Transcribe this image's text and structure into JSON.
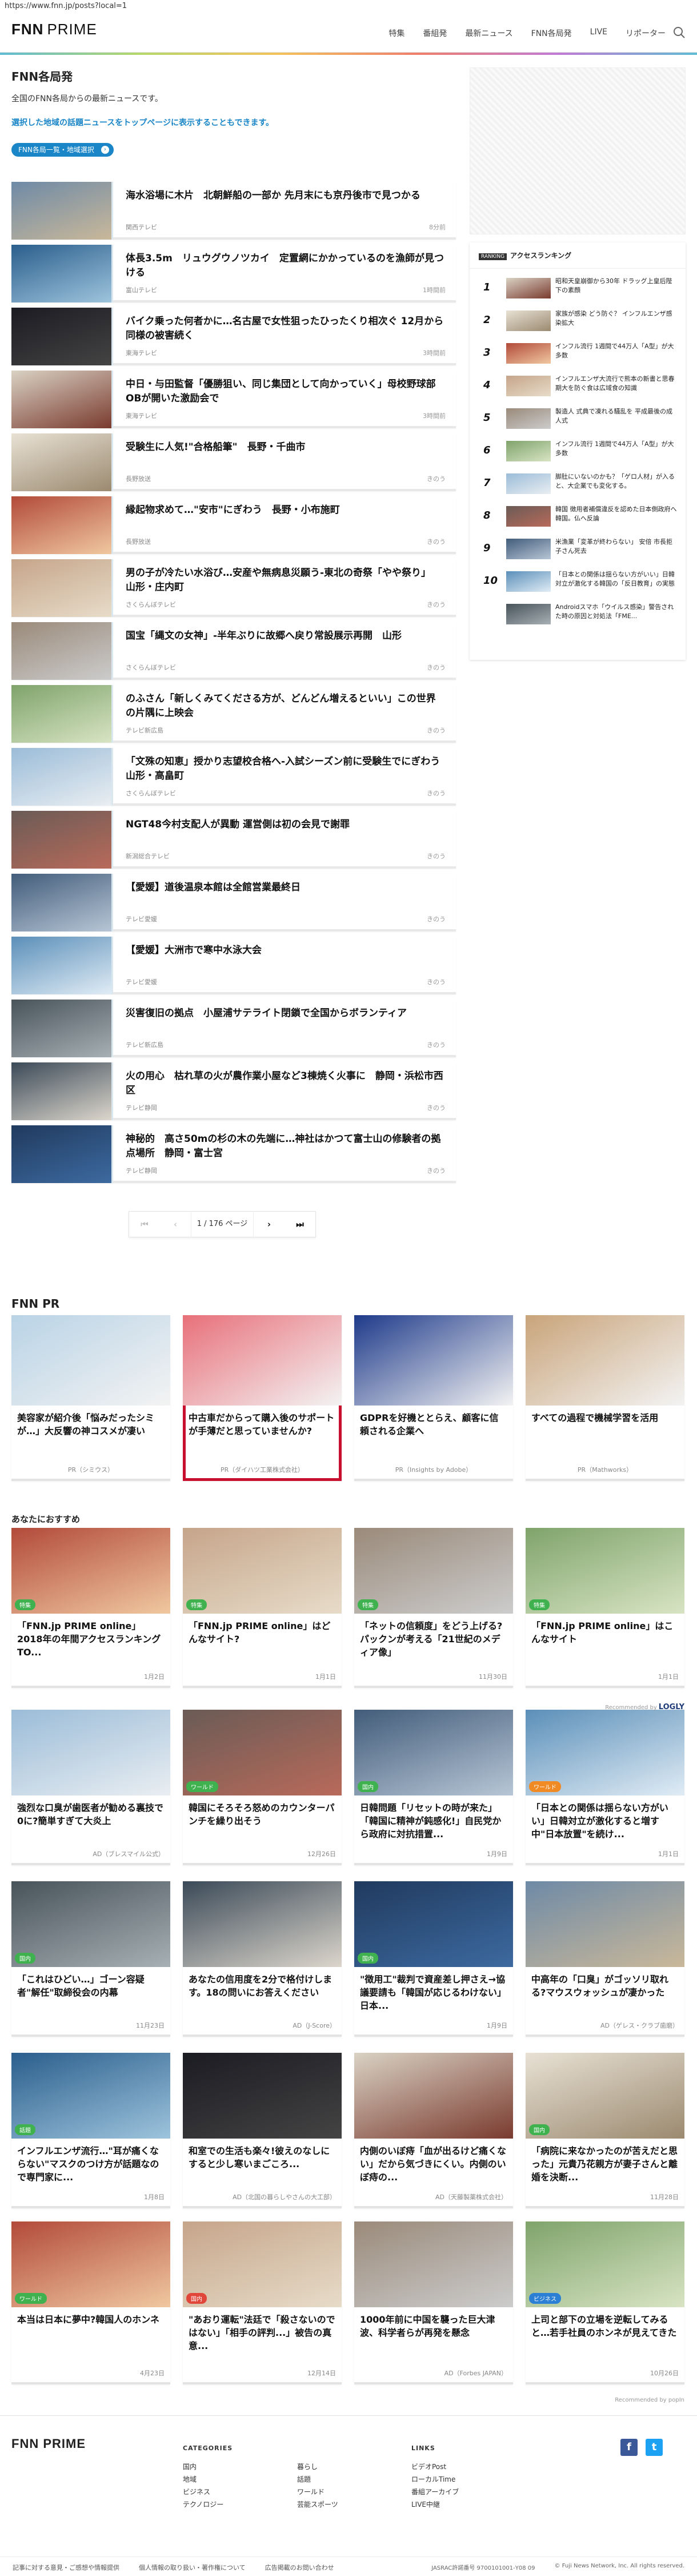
{
  "url": "https://www.fnn.jp/posts?local=1",
  "site": {
    "logo": "FNN",
    "logo_sub": "PRIME",
    "nav": [
      "特集",
      "番組発",
      "最新ニュース",
      "FNN各局発",
      "LIVE",
      "リポーター"
    ]
  },
  "page": {
    "title": "FNN各局発",
    "desc": "全国のFNN各局からの最新ニュースです。",
    "desc2": "選択した地域の話題ニュースをトップページに表示することもできます。",
    "region_button": "FNN各局一覧・地域選択"
  },
  "news": [
    {
      "title": "海水浴場に木片　北朝鮮船の一部か 先月末にも京丹後市で見つかる",
      "source": "関西テレビ",
      "date": "8分前"
    },
    {
      "title": "体長3.5m　リュウグウノツカイ　定置網にかかっているのを漁師が見つける",
      "source": "富山テレビ",
      "date": "1時間前"
    },
    {
      "title": "バイク乗った何者かに…名古屋で女性狙ったひったくり相次ぐ 12月から同様の被害続く",
      "source": "東海テレビ",
      "date": "3時間前"
    },
    {
      "title": "中日・与田監督「優勝狙い、同じ集団として向かっていく」母校野球部OBが開いた激励会で",
      "source": "東海テレビ",
      "date": "3時間前"
    },
    {
      "title": "受験生に人気!\"合格船筆\"　長野・千曲市",
      "source": "長野放送",
      "date": "きのう"
    },
    {
      "title": "縁起物求めて…\"安市\"にぎわう　長野・小布施町",
      "source": "長野放送",
      "date": "きのう"
    },
    {
      "title": "男の子が冷たい水浴び…安産や無病息災願う-東北の奇祭「やや祭り」　山形・庄内町",
      "source": "さくらんぼテレビ",
      "date": "きのう"
    },
    {
      "title": "国宝「縄文の女神」-半年ぶりに故郷へ戻り常設展示再開　山形",
      "source": "さくらんぼテレビ",
      "date": "きのう"
    },
    {
      "title": "のふさん「新しくみてくださる方が、どんどん増えるといい」この世界の片隅に上映会",
      "source": "テレビ新広島",
      "date": "きのう"
    },
    {
      "title": "「文殊の知恵」授かり志望校合格へ-入試シーズン前に受験生でにぎわう　山形・高畠町",
      "source": "さくらんぼテレビ",
      "date": "きのう"
    },
    {
      "title": "NGT48今村支配人が異動 運営側は初の会見で謝罪",
      "source": "新潟総合テレビ",
      "date": "きのう"
    },
    {
      "title": "【愛媛】道後温泉本館は全館営業最終日",
      "source": "テレビ愛媛",
      "date": "きのう"
    },
    {
      "title": "【愛媛】大洲市で寒中水泳大会",
      "source": "テレビ愛媛",
      "date": "きのう"
    },
    {
      "title": "災害復旧の拠点　小屋浦サテライト閉鎖で全国からボランティア",
      "source": "テレビ新広島",
      "date": "きのう"
    },
    {
      "title": "火の用心　枯れ草の火が農作業小屋など3棟焼く火事に　静岡・浜松市西区",
      "source": "テレビ静岡",
      "date": "きのう"
    },
    {
      "title": "神秘的　高さ50mの杉の木の先端に…神社はかつて富士山の修験者の拠点場所　静岡・富士宮",
      "source": "テレビ静岡",
      "date": "きのう"
    }
  ],
  "pager": {
    "first": "⏮",
    "prev": "‹",
    "current": "1 / 176 ページ",
    "next": "›",
    "last": "⏭"
  },
  "ranking": {
    "tag": "RANKING",
    "title": "アクセスランキング",
    "items": [
      {
        "n": "1",
        "text": "昭和天皇崩御から30年 ドラッグ上皇后陛下の素顔"
      },
      {
        "n": "2",
        "text": "家族が感染 どう防ぐ？ インフルエンザ感染拡大"
      },
      {
        "n": "3",
        "text": "インフル流行 1週間で44万人「A型」が大多数"
      },
      {
        "n": "4",
        "text": "インフルエンザ大流行で熊本の新書と思春期大を防ぐ食は広域食の知識"
      },
      {
        "n": "5",
        "text": "製造人 式典で凍れる騒乱を 平成最後の成人式"
      },
      {
        "n": "6",
        "text": "インフル流行 1週間で44万人「A型」が大多数"
      },
      {
        "n": "7",
        "text": "脚肚にいないのかも？「ゲロ人材」が入ると、大企業でも変化する。"
      },
      {
        "n": "8",
        "text": "韓国 徴用者補償違反を認めた日本側政府へ 韓国。仏へ反論"
      },
      {
        "n": "9",
        "text": "米漁業「変革が終わらない」 安倍 市長拒子さん死去"
      },
      {
        "n": "10",
        "text": "「日本との関係は揺らない方がいい」日韓対立が激化する韓国の「反日教育」の実態"
      },
      {
        "n": "",
        "text": "Androidスマホ「ウイルス感染」警告された時の原因と対処法「FME..."
      }
    ]
  },
  "pr": {
    "heading": "FNN PR",
    "items": [
      {
        "title": "美容家が紹介後「悩みだったシミが…」大反響の神コスメが凄い",
        "source": "PR（シミウス）"
      },
      {
        "title": "中古車だからって購入後のサポートが手薄だと思っていませんか?",
        "source": "PR（ダイハツ工業株式会社）"
      },
      {
        "title": "GDPRを好機ととらえ、顧客に信頼される企業へ",
        "source": "PR（Insights by Adobe）"
      },
      {
        "title": "すべての過程で機械学習を活用",
        "source": "PR（Mathworks）"
      }
    ]
  },
  "recommend": {
    "heading": "あなたにおすすめ",
    "logly": "Recommended by",
    "logly_name": "LOGLY",
    "popin": "Recommended by popIn",
    "rows": [
      [
        {
          "title": "「FNN.jp PRIME online」2018年の年間アクセスランキングTO...",
          "date": "1月2日",
          "badge": "特集",
          "bc": "green"
        },
        {
          "title": "「FNN.jp PRIME online」はどんなサイト?",
          "date": "1月1日",
          "badge": "特集",
          "bc": "green"
        },
        {
          "title": "「ネットの信頼度」をどう上げる? パックンが考える「21世紀のメディア像」",
          "date": "11月30日",
          "badge": "特集",
          "bc": "green"
        },
        {
          "title": "「FNN.jp PRIME online」はこんなサイト",
          "date": "1月1日",
          "badge": "特集",
          "bc": "green"
        }
      ],
      [
        {
          "title": "強烈な口臭が歯医者が勧める裏技で0に?簡単すぎて大炎上",
          "date": "AD（ブレスマイル公式）",
          "badge": "",
          "bc": ""
        },
        {
          "title": "韓国にそろそろ怒めのカウンターパンチを繰り出そう",
          "date": "12月26日",
          "badge": "ワールド",
          "bc": "green"
        },
        {
          "title": "日韓問題「リセットの時が来た」「韓国に精神が鈍感化!」自民党から政府に対抗措置...",
          "date": "1月9日",
          "badge": "国内",
          "bc": "green"
        },
        {
          "title": "「日本との関係は揺らない方がいい」日韓対立が激化すると増す中\"日本放置\"を続け...",
          "date": "1月1日",
          "badge": "ワールド",
          "bc": "orange"
        }
      ],
      [
        {
          "title": "「これはひどい…」ゴーン容疑者\"解任\"取締役会の内幕",
          "date": "11月23日",
          "badge": "国内",
          "bc": "green"
        },
        {
          "title": "あなたの信用度を2分で格付けします。18の問いにお答えください",
          "date": "AD（J-Score）",
          "badge": "",
          "bc": ""
        },
        {
          "title": "\"徴用工\"裁判で資産差し押さえ→協議要請も「韓国が応じるわけない」　日本...",
          "date": "1月9日",
          "badge": "国内",
          "bc": "green"
        },
        {
          "title": "中高年の「口臭」がゴッソリ取れる?マウスウォッシュが凄かった",
          "date": "AD（ゲレス・クラブ歯磨）",
          "badge": "",
          "bc": ""
        }
      ],
      [
        {
          "title": "インフルエンザ流行…\"耳が痛くならない\"マスクのつけ方が話題なので専門家に...",
          "date": "1月8日",
          "badge": "話題",
          "bc": "green"
        },
        {
          "title": "和室での生活も楽々!彼えのなしにすると少し寒いまごころ...",
          "date": "AD（北国の暮らしやさんの大工部）",
          "badge": "",
          "bc": ""
        },
        {
          "title": "内側のいぼ痔「血が出るけど痛くない」だから気づきにくい。内側のいぼ痔の...",
          "date": "AD（天藤製薬株式会社）",
          "badge": "",
          "bc": ""
        },
        {
          "title": "「病院に来なかったのが苦えだと思った」元貴乃花親方が妻子さんと離婚を決断...",
          "date": "11月28日",
          "badge": "国内",
          "bc": "green"
        }
      ],
      [
        {
          "title": "本当は日本に夢中?韓国人のホンネ",
          "date": "4月23日",
          "badge": "ワールド",
          "bc": "green"
        },
        {
          "title": "\"あおり運転\"法廷で「殺さないのではない」「相手の評判...」被告の真意...",
          "date": "12月14日",
          "badge": "国内",
          "bc": "red"
        },
        {
          "title": "1000年前に中国を襲った巨大津波、科学者らが再発を懸念",
          "date": "AD（Forbes JAPAN）",
          "badge": "",
          "bc": ""
        },
        {
          "title": "上司と部下の立場を逆転してみると…若手社員のホンネが見えてきた",
          "date": "10月26日",
          "badge": "ビジネス",
          "bc": "blue"
        }
      ]
    ]
  },
  "footer": {
    "logo": "FNN PRIME",
    "cat_h": "CATEGORIES",
    "cats": [
      [
        "国内",
        "暮らし"
      ],
      [
        "地域",
        "話題"
      ],
      [
        "ビジネス",
        "ワールド"
      ],
      [
        "テクノロジー",
        "芸能スポーツ"
      ]
    ],
    "links_h": "LINKS",
    "links": [
      "ビデオPost",
      "ローカルTime",
      "番組アーカイブ",
      "LIVE中継"
    ],
    "bottom": [
      "記事に対する意見・ご感想や情報提供",
      "個人情報の取り扱い・著作権について",
      "広告掲載のお問い合わせ"
    ],
    "jasrac": "JASRAC許諾番号 9700101001-Y08 09",
    "copy": "© Fuji News Network, Inc. All rights reserved."
  }
}
